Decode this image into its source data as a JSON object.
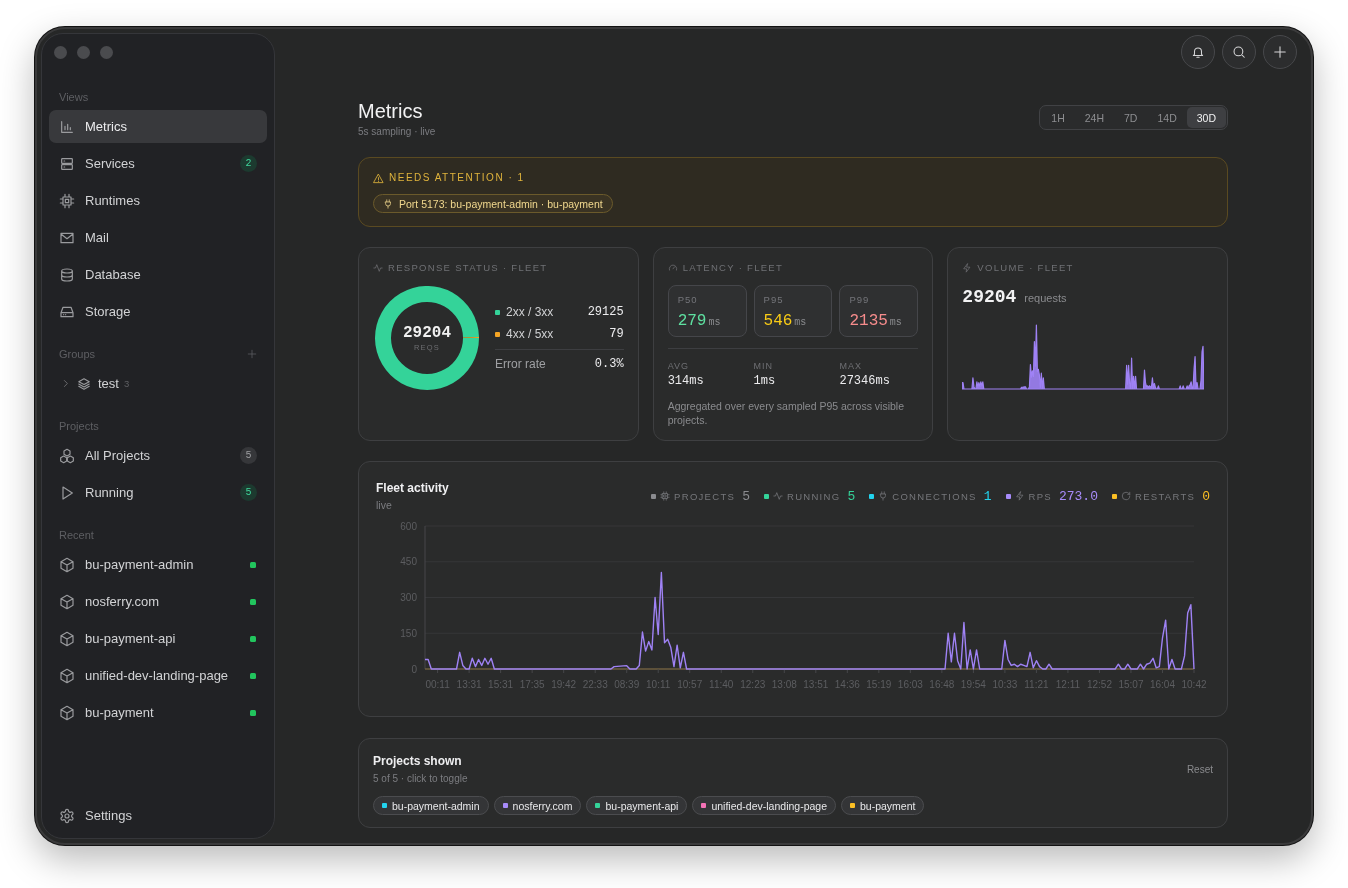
{
  "sidebar": {
    "views": {
      "heading": "Views",
      "items": [
        {
          "label": "Metrics",
          "selected": true
        },
        {
          "label": "Services",
          "selected": false,
          "badge": "2",
          "badge_active": true
        },
        {
          "label": "Runtimes",
          "selected": false
        },
        {
          "label": "Mail",
          "selected": false
        },
        {
          "label": "Database",
          "selected": false
        },
        {
          "label": "Storage",
          "selected": false
        }
      ]
    },
    "groups": {
      "heading": "Groups",
      "items": [
        {
          "label": "test",
          "count": "3",
          "expanded": false,
          "selected": false
        }
      ]
    },
    "projects": {
      "heading": "Projects",
      "items": [
        {
          "label": "All Projects",
          "selected": false,
          "badge": "5",
          "badge_active": false
        },
        {
          "label": "Running",
          "selected": false,
          "badge": "5",
          "badge_active": true
        }
      ]
    },
    "recent": {
      "heading": "Recent",
      "items": [
        {
          "label": "bu-payment-admin",
          "selected": false,
          "running": true
        },
        {
          "label": "nosferry.com",
          "selected": false,
          "running": true
        },
        {
          "label": "bu-payment-api",
          "selected": false,
          "running": true
        },
        {
          "label": "unified-dev-landing-page",
          "selected": false,
          "running": true
        },
        {
          "label": "bu-payment",
          "selected": false,
          "running": true
        }
      ]
    },
    "settings": {
      "label": "Settings",
      "selected": false
    }
  },
  "page": {
    "title": "Metrics",
    "subtitle": "5s sampling · live"
  },
  "time_range": [
    {
      "label": "1H",
      "selected": false
    },
    {
      "label": "24H",
      "selected": false
    },
    {
      "label": "7D",
      "selected": false
    },
    {
      "label": "14D",
      "selected": false
    },
    {
      "label": "30D",
      "selected": true
    }
  ],
  "attention": {
    "title": "NEEDS ATTENTION · 1",
    "items": [
      "Port 5173: bu-payment-admin · bu-payment"
    ]
  },
  "response_status": {
    "title": "RESPONSE STATUS · FLEET",
    "total": "29204",
    "total_label": "REQS",
    "legend": [
      {
        "value": "29125",
        "color": "#34d399"
      },
      {
        "value": "79",
        "color": "#f5a524"
      }
    ],
    "error_rate_label": "Error rate",
    "error_rate": "0.3%",
    "chart_data": {
      "type": "donut",
      "categories": [
        "2xx / 3xx",
        "4xx / 5xx"
      ],
      "values": [
        99.73,
        0.27
      ]
    }
  },
  "latency": {
    "title": "LATENCY · FLEET",
    "percentiles": [
      {
        "label": "P50",
        "value": "279",
        "unit": "ms",
        "color": "#5ee0a0"
      },
      {
        "label": "P95",
        "value": "546",
        "unit": "ms",
        "color": "#facc15"
      },
      {
        "label": "P99",
        "value": "2135",
        "unit": "ms",
        "color": "#f78c8c"
      }
    ],
    "stats": [
      {
        "label": "AVG",
        "value": "314ms"
      },
      {
        "label": "MIN",
        "value": "1ms"
      },
      {
        "label": "MAX",
        "value": "27346ms"
      }
    ],
    "note": "Aggregated over every sampled P95 across visible projects."
  },
  "volume": {
    "title": "VOLUME · FLEET",
    "total": "29204",
    "unit": "requests"
  },
  "fleet_activity": {
    "title": "Fleet activity",
    "subtitle": "live",
    "legend": [
      {
        "kind": "projects",
        "label": "PROJECTS",
        "value": "5",
        "color": "#8a8b8f"
      },
      {
        "kind": "running",
        "label": "RUNNING",
        "value": "5",
        "color": "#34d399"
      },
      {
        "kind": "connections",
        "label": "CONNECTIONS",
        "value": "1",
        "color": "#22d3ee"
      },
      {
        "kind": "rps",
        "label": "RPS",
        "value": "273.0",
        "color": "#a78bfa"
      },
      {
        "kind": "restarts",
        "label": "RESTARTS",
        "value": "0",
        "color": "#fbbf24"
      }
    ],
    "chart_data": {
      "type": "line",
      "grid": true,
      "ylim": [
        0,
        600
      ],
      "yticks": [
        0,
        150,
        300,
        450,
        600
      ],
      "categories": [
        null,
        null,
        null,
        null,
        "00:11",
        null,
        null,
        null,
        null,
        null,
        null,
        null,
        null,
        null,
        "13:31",
        null,
        null,
        null,
        null,
        null,
        null,
        null,
        null,
        null,
        "15:31",
        null,
        null,
        null,
        null,
        null,
        null,
        null,
        null,
        null,
        "17:35",
        null,
        null,
        null,
        null,
        null,
        null,
        null,
        null,
        null,
        "19:42",
        null,
        null,
        null,
        null,
        null,
        null,
        null,
        null,
        null,
        "22:33",
        null,
        null,
        null,
        null,
        null,
        null,
        null,
        null,
        null,
        "08:39",
        null,
        null,
        null,
        null,
        null,
        null,
        null,
        null,
        null,
        "10:11",
        null,
        null,
        null,
        null,
        null,
        null,
        null,
        null,
        null,
        "10:57",
        null,
        null,
        null,
        null,
        null,
        null,
        null,
        null,
        null,
        "11:40",
        null,
        null,
        null,
        null,
        null,
        null,
        null,
        null,
        null,
        "12:23",
        null,
        null,
        null,
        null,
        null,
        null,
        null,
        null,
        null,
        "13:08",
        null,
        null,
        null,
        null,
        null,
        null,
        null,
        null,
        null,
        "13:51",
        null,
        null,
        null,
        null,
        null,
        null,
        null,
        null,
        null,
        "14:36",
        null,
        null,
        null,
        null,
        null,
        null,
        null,
        null,
        null,
        "15:19",
        null,
        null,
        null,
        null,
        null,
        null,
        null,
        null,
        null,
        "16:03",
        null,
        null,
        null,
        null,
        null,
        null,
        null,
        null,
        null,
        "16:48",
        null,
        null,
        null,
        null,
        null,
        null,
        null,
        null,
        null,
        "19:54",
        null,
        null,
        null,
        null,
        null,
        null,
        null,
        null,
        null,
        "10:33",
        null,
        null,
        null,
        null,
        null,
        null,
        null,
        null,
        null,
        "11:21",
        null,
        null,
        null,
        null,
        null,
        null,
        null,
        null,
        null,
        "12:11",
        null,
        null,
        null,
        null,
        null,
        null,
        null,
        null,
        null,
        "12:52",
        null,
        null,
        null,
        null,
        null,
        null,
        null,
        null,
        null,
        "15:07",
        null,
        null,
        null,
        null,
        null,
        null,
        null,
        null,
        null,
        "16:04",
        null,
        null,
        null,
        null,
        null,
        null,
        null,
        null,
        null,
        "10:42"
      ],
      "series": [
        {
          "color": "#9f82f5",
          "values": [
            40,
            40,
            0,
            0,
            0,
            0,
            0,
            0,
            0,
            0,
            0,
            70,
            15,
            0,
            0,
            45,
            10,
            40,
            15,
            45,
            20,
            45,
            0,
            0,
            0,
            0,
            0,
            0,
            0,
            0,
            0,
            0,
            0,
            0,
            0,
            0,
            0,
            0,
            0,
            0,
            0,
            0,
            0,
            0,
            0,
            0,
            0,
            0,
            0,
            0,
            0,
            0,
            0,
            0,
            0,
            0,
            0,
            0,
            0,
            0,
            10,
            11,
            12,
            13,
            14,
            0,
            0,
            0,
            15,
            155,
            75,
            115,
            80,
            300,
            145,
            405,
            110,
            125,
            90,
            10,
            100,
            5,
            70,
            0,
            0,
            0,
            0,
            0,
            0,
            0,
            0,
            0,
            0,
            0,
            0,
            0,
            0,
            0,
            0,
            0,
            0,
            0,
            0,
            0,
            0,
            0,
            0,
            0,
            0,
            0,
            0,
            0,
            0,
            0,
            0,
            0,
            0,
            0,
            0,
            0,
            0,
            0,
            0,
            0,
            0,
            0,
            0,
            0,
            0,
            0,
            0,
            0,
            0,
            0,
            0,
            0,
            0,
            0,
            0,
            0,
            0,
            0,
            0,
            0,
            0,
            0,
            0,
            0,
            0,
            0,
            0,
            0,
            0,
            0,
            0,
            0,
            0,
            0,
            0,
            0,
            0,
            0,
            0,
            0,
            0,
            0,
            150,
            30,
            150,
            35,
            0,
            195,
            0,
            80,
            0,
            80,
            0,
            0,
            0,
            0,
            0,
            0,
            0,
            0,
            120,
            40,
            15,
            20,
            10,
            20,
            15,
            10,
            70,
            5,
            35,
            10,
            0,
            0,
            20,
            0,
            0,
            0,
            0,
            0,
            0,
            0,
            0,
            0,
            0,
            0,
            0,
            0,
            0,
            0,
            0,
            0,
            0,
            0,
            0,
            0,
            20,
            0,
            0,
            20,
            0,
            0,
            0,
            20,
            0,
            20,
            25,
            45,
            5,
            10,
            130,
            205,
            0,
            40,
            0,
            0,
            0,
            55,
            235,
            270,
            0
          ]
        }
      ]
    }
  },
  "projects_shown": {
    "title": "Projects shown",
    "subtitle": "5 of 5 · click to toggle",
    "reset": "Reset",
    "chips": [
      {
        "label": "bu-payment-admin",
        "color": "#22d3ee",
        "selected": true
      },
      {
        "label": "nosferry.com",
        "color": "#a78bfa",
        "selected": true
      },
      {
        "label": "bu-payment-api",
        "color": "#34d399",
        "selected": true
      },
      {
        "label": "unified-dev-landing-page",
        "color": "#f472b6",
        "selected": true
      },
      {
        "label": "bu-payment",
        "color": "#fbbf24",
        "selected": true
      }
    ]
  }
}
